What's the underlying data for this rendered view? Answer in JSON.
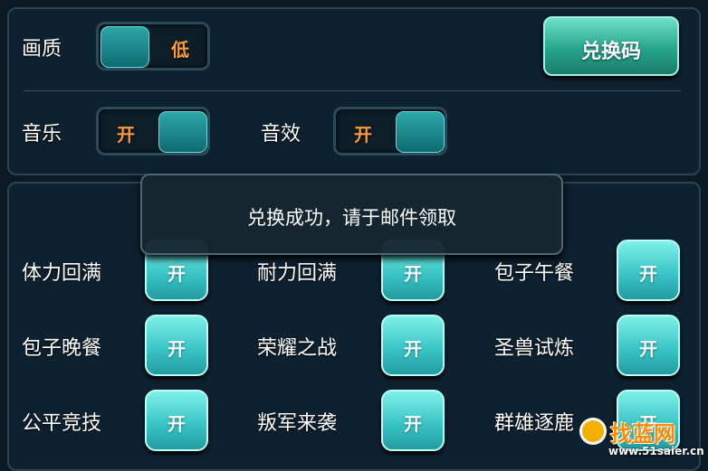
{
  "settings": {
    "quality_label": "画质",
    "quality_value": "低",
    "music_label": "音乐",
    "music_value": "开",
    "sound_label": "音效",
    "sound_value": "开",
    "redeem_button": "兑换码"
  },
  "toast": {
    "message": "兑换成功，请于邮件领取"
  },
  "notifications": [
    {
      "label": "体力回满",
      "state": "开"
    },
    {
      "label": "耐力回满",
      "state": "开"
    },
    {
      "label": "包子午餐",
      "state": "开"
    },
    {
      "label": "包子晚餐",
      "state": "开"
    },
    {
      "label": "荣耀之战",
      "state": "开"
    },
    {
      "label": "圣兽试炼",
      "state": "开"
    },
    {
      "label": "公平竞技",
      "state": "开"
    },
    {
      "label": "叛军来袭",
      "state": "开"
    },
    {
      "label": "群雄逐鹿",
      "state": "开"
    }
  ],
  "watermark": {
    "title": "找蓝网",
    "url": "www.51saier.cn"
  },
  "colors": {
    "accent": "#36c2c4",
    "toggle_text": "#ff9a3a",
    "panel_bg": "#0e2130"
  }
}
